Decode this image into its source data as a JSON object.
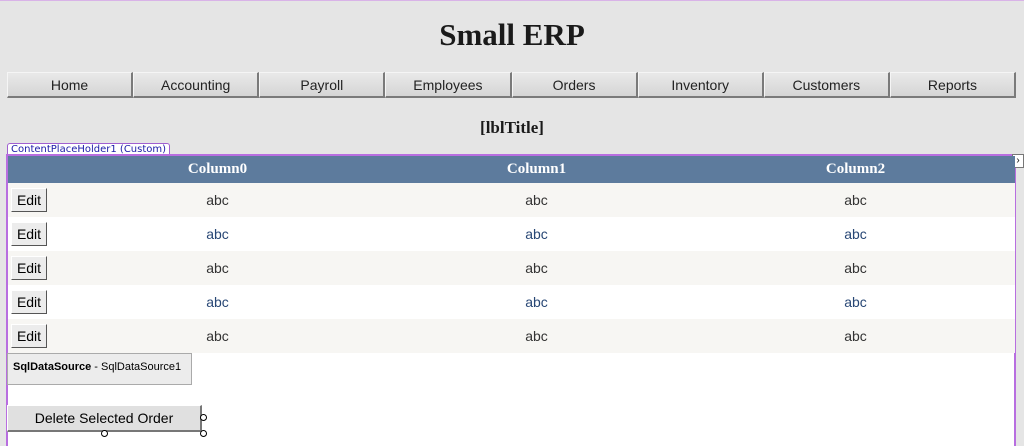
{
  "header": {
    "title": "Small ERP"
  },
  "menu": {
    "items": [
      {
        "label": "Home"
      },
      {
        "label": "Accounting"
      },
      {
        "label": "Payroll"
      },
      {
        "label": "Employees"
      },
      {
        "label": "Orders"
      },
      {
        "label": "Inventory"
      },
      {
        "label": "Customers"
      },
      {
        "label": "Reports"
      }
    ]
  },
  "page": {
    "label": "[lblTitle]"
  },
  "content_placeholder": {
    "tab_label": "ContentPlaceHolder1 (Custom)",
    "arrow": "›"
  },
  "grid": {
    "columns": [
      "Column0",
      "Column1",
      "Column2"
    ],
    "edit_label": "Edit",
    "rows": [
      [
        "abc",
        "abc",
        "abc"
      ],
      [
        "abc",
        "abc",
        "abc"
      ],
      [
        "abc",
        "abc",
        "abc"
      ],
      [
        "abc",
        "abc",
        "abc"
      ],
      [
        "abc",
        "abc",
        "abc"
      ]
    ]
  },
  "data_source": {
    "type": "SqlDataSource",
    "separator": " - ",
    "id": "SqlDataSource1"
  },
  "actions": {
    "delete_label": "Delete Selected Order"
  },
  "colors": {
    "header_bg": "#5d7b9d",
    "row_odd": "#f7f6f3",
    "row_even_text": "#284775",
    "placeholder_border": "#b86ee0"
  }
}
